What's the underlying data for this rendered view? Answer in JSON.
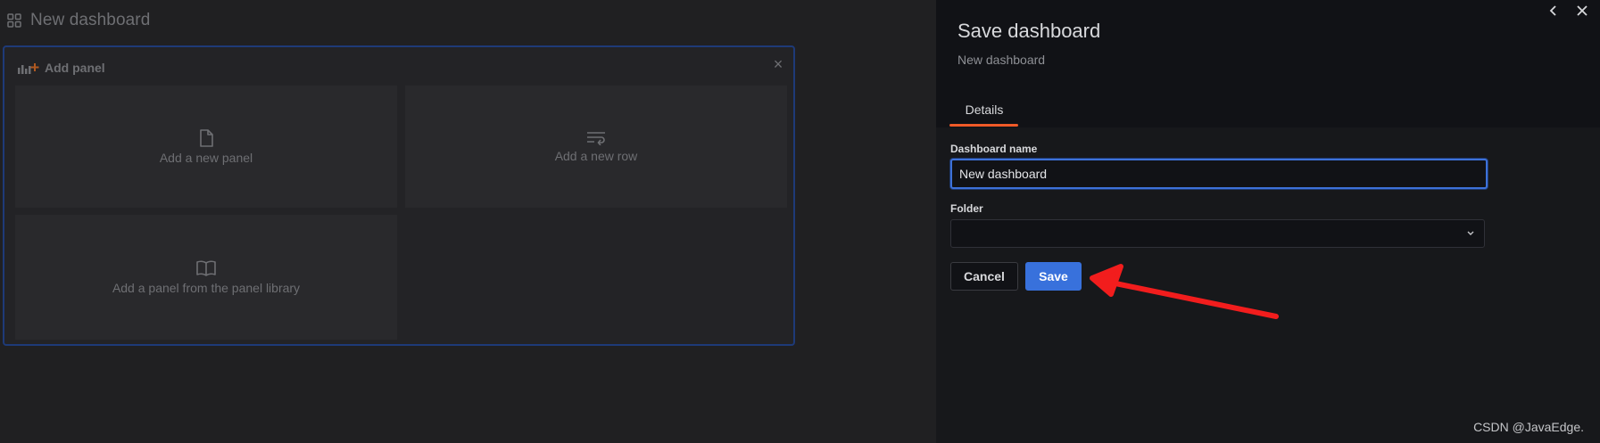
{
  "dashboard": {
    "title": "New dashboard",
    "add_panel": {
      "title": "Add panel",
      "close_glyph": "×",
      "options": [
        {
          "label": "Add a new panel",
          "icon": "file-icon"
        },
        {
          "label": "Add a new row",
          "icon": "row-icon"
        },
        {
          "label": "Add a panel from the panel library",
          "icon": "book-open-icon"
        }
      ]
    }
  },
  "drawer": {
    "title": "Save dashboard",
    "subtitle": "New dashboard",
    "icons": [
      "chevron-left-icon",
      "close-icon"
    ],
    "tabs": [
      {
        "label": "Details",
        "active": true
      }
    ],
    "fields": {
      "name": {
        "label": "Dashboard name",
        "value": "New dashboard"
      },
      "folder": {
        "label": "Folder",
        "value": ""
      }
    },
    "buttons": {
      "cancel": "Cancel",
      "save": "Save"
    }
  },
  "watermark": "CSDN @JavaEdge.",
  "colors": {
    "accent": "#3871dc",
    "tab_underline": "#f05a28",
    "annotation_arrow": "#f21d1d",
    "focus_border": "#3d71d9"
  }
}
